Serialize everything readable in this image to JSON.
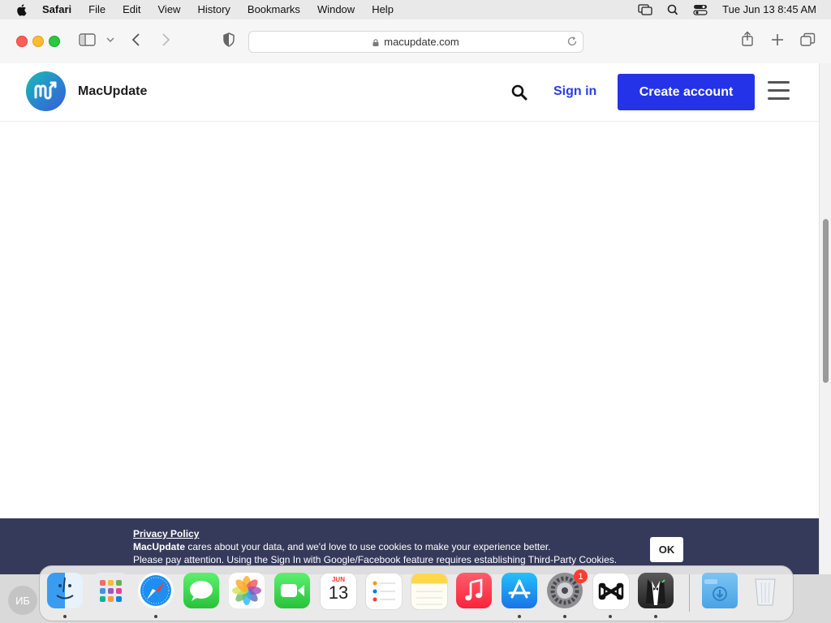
{
  "menubar": {
    "app_name": "Safari",
    "items": [
      "File",
      "Edit",
      "View",
      "History",
      "Bookmarks",
      "Window",
      "Help"
    ],
    "clock": "Tue Jun 13  8:45 AM",
    "status_icons": [
      "screen-mirroring-icon",
      "spotlight-icon",
      "control-center-icon"
    ]
  },
  "browser": {
    "url": "macupdate.com",
    "toolbar_icons": [
      "sidebar-icon",
      "chevron-down-icon",
      "back-icon",
      "forward-icon",
      "privacy-shield-icon",
      "share-icon",
      "new-tab-icon",
      "tab-overview-icon"
    ]
  },
  "site": {
    "name": "MacUpdate",
    "logo_letters": "mu",
    "signin_label": "Sign in",
    "create_account_label": "Create account"
  },
  "cookie_banner": {
    "title": "Privacy Policy",
    "brand": "MacUpdate",
    "line1_rest": " cares about your data, and we'd love to use cookies to make your experience better.",
    "line2": "Please pay attention. Using the Sign In with Google/Facebook feature requires establishing Third-Party Cookies.",
    "ok_label": "OK"
  },
  "dock": {
    "user_initials": "ИБ",
    "calendar_month": "JUN",
    "calendar_day": "13",
    "settings_badge": "1",
    "apps": [
      "Finder",
      "Launchpad",
      "Safari",
      "Messages",
      "Photos",
      "FaceTime",
      "Calendar",
      "Reminders",
      "Notes",
      "Music",
      "App Store",
      "System Settings",
      "CapCut",
      "Bartender",
      "Downloads",
      "Trash"
    ]
  },
  "colors": {
    "accent": "#2433e8",
    "link": "#2a3ee8",
    "banner": "#363a5a"
  }
}
